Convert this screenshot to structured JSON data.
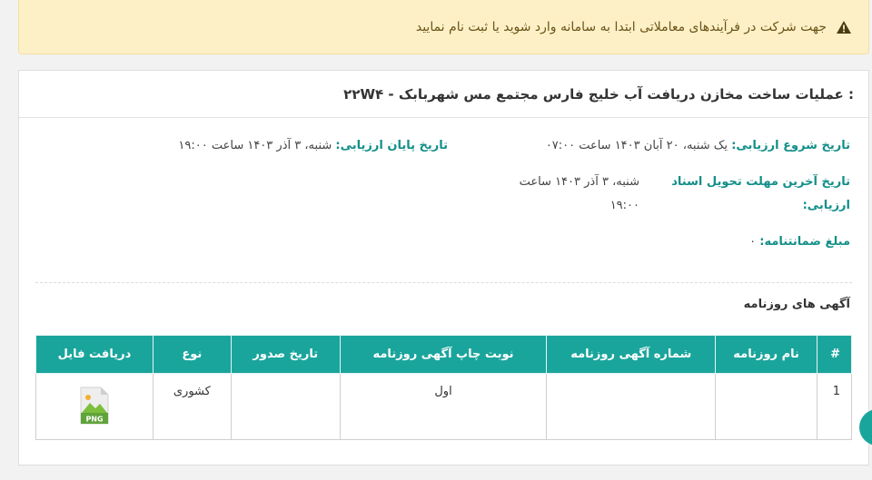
{
  "alert": {
    "text": "جهت شرکت در فرآیندهای معاملاتی ابتدا به سامانه وارد شوید یا ثبت نام نمایید",
    "icon": "warning-icon"
  },
  "card": {
    "title": ": عملیات ساخت مخازن دریافت آب خلیج فارس مجتمع مس شهربابک - ۲۲W۴"
  },
  "details": {
    "start_label": "تاریخ شروع ارزیابی:",
    "start_value": "یک شنبه، ۲۰ آبان ۱۴۰۳ ساعت ۰۷:۰۰",
    "end_label": "تاریخ پایان ارزیابی:",
    "end_value": "شنبه، ۳ آذر ۱۴۰۳ ساعت ۱۹:۰۰",
    "deadline_label": "تاریخ آخرین مهلت تحویل اسناد ارزیابی:",
    "deadline_value": "شنبه، ۳ آذر ۱۴۰۳ ساعت ۱۹:۰۰",
    "guarantee_label": "مبلغ ضمانتنامه:",
    "guarantee_value": "۰"
  },
  "ads": {
    "title": "آگهی های روزنامه",
    "columns": [
      "#",
      "نام روزنامه",
      "شماره آگهی روزنامه",
      "نوبت چاپ آگهی روزنامه",
      "تاریخ صدور",
      "نوع",
      "دریافت فایل"
    ],
    "rows": [
      {
        "num": "1",
        "name": "",
        "ad_number": "",
        "round": "اول",
        "issue_date": "",
        "type": "کشوری",
        "file_icon": "png-file-icon",
        "file_badge": "PNG"
      }
    ]
  },
  "colors": {
    "accent": "#1aa59c",
    "label": "#138f89",
    "alert_bg": "#fdf0c7"
  }
}
